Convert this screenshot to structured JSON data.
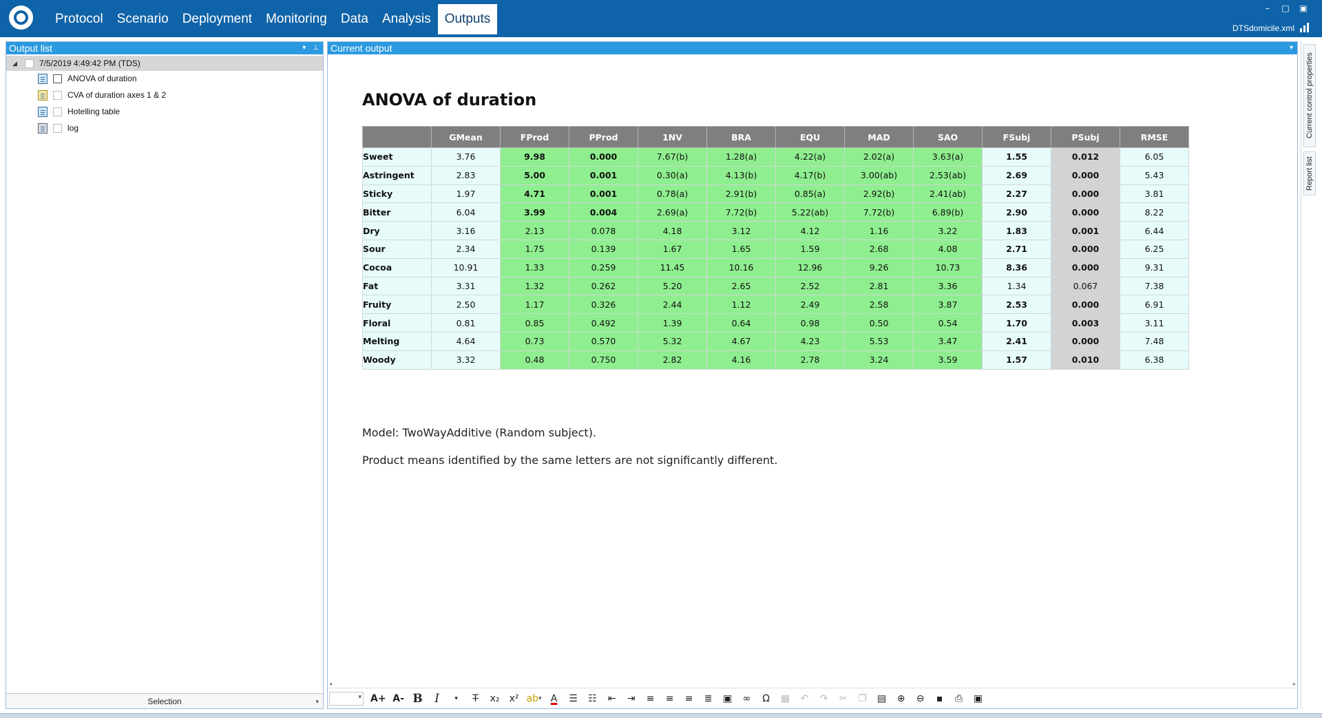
{
  "menu": {
    "items": [
      "Protocol",
      "Scenario",
      "Deployment",
      "Monitoring",
      "Data",
      "Analysis",
      "Outputs"
    ],
    "active": "Outputs"
  },
  "window": {
    "filename": "DTSdomicile.xml",
    "controls": {
      "minimize": "–",
      "restore": "□",
      "maximize": "▣"
    }
  },
  "output_list": {
    "title": "Output list",
    "root": "7/5/2019 4:49:42 PM (TDS)",
    "items": [
      "ANOVA of duration",
      "CVA of duration axes 1 & 2",
      "Hotelling table",
      "log"
    ],
    "footer": "Selection"
  },
  "current_output": {
    "title": "Current output",
    "doc_title": "ANOVA of duration",
    "columns": [
      "",
      "GMean",
      "FProd",
      "PProd",
      "1NV",
      "BRA",
      "EQU",
      "MAD",
      "SAO",
      "FSubj",
      "PSubj",
      "RMSE"
    ],
    "rows": [
      [
        "Sweet",
        "3.76",
        "9.98",
        "0.000",
        "7.67(b)",
        "1.28(a)",
        "4.22(a)",
        "2.02(a)",
        "3.63(a)",
        "1.55",
        "0.012",
        "6.05"
      ],
      [
        "Astringent",
        "2.83",
        "5.00",
        "0.001",
        "0.30(a)",
        "4.13(b)",
        "4.17(b)",
        "3.00(ab)",
        "2.53(ab)",
        "2.69",
        "0.000",
        "5.43"
      ],
      [
        "Sticky",
        "1.97",
        "4.71",
        "0.001",
        "0.78(a)",
        "2.91(b)",
        "0.85(a)",
        "2.92(b)",
        "2.41(ab)",
        "2.27",
        "0.000",
        "3.81"
      ],
      [
        "Bitter",
        "6.04",
        "3.99",
        "0.004",
        "2.69(a)",
        "7.72(b)",
        "5.22(ab)",
        "7.72(b)",
        "6.89(b)",
        "2.90",
        "0.000",
        "8.22"
      ],
      [
        "Dry",
        "3.16",
        "2.13",
        "0.078",
        "4.18",
        "3.12",
        "4.12",
        "1.16",
        "3.22",
        "1.83",
        "0.001",
        "6.44"
      ],
      [
        "Sour",
        "2.34",
        "1.75",
        "0.139",
        "1.67",
        "1.65",
        "1.59",
        "2.68",
        "4.08",
        "2.71",
        "0.000",
        "6.25"
      ],
      [
        "Cocoa",
        "10.91",
        "1.33",
        "0.259",
        "11.45",
        "10.16",
        "12.96",
        "9.26",
        "10.73",
        "8.36",
        "0.000",
        "9.31"
      ],
      [
        "Fat",
        "3.31",
        "1.32",
        "0.262",
        "5.20",
        "2.65",
        "2.52",
        "2.81",
        "3.36",
        "1.34",
        "0.067",
        "7.38"
      ],
      [
        "Fruity",
        "2.50",
        "1.17",
        "0.326",
        "2.44",
        "1.12",
        "2.49",
        "2.58",
        "3.87",
        "2.53",
        "0.000",
        "6.91"
      ],
      [
        "Floral",
        "0.81",
        "0.85",
        "0.492",
        "1.39",
        "0.64",
        "0.98",
        "0.50",
        "0.54",
        "1.70",
        "0.003",
        "3.11"
      ],
      [
        "Melting",
        "4.64",
        "0.73",
        "0.570",
        "5.32",
        "4.67",
        "4.23",
        "5.53",
        "3.47",
        "2.41",
        "0.000",
        "7.48"
      ],
      [
        "Woody",
        "3.32",
        "0.48",
        "0.750",
        "2.82",
        "4.16",
        "2.78",
        "3.24",
        "3.59",
        "1.57",
        "0.010",
        "6.38"
      ]
    ],
    "significant_product_rows": 4,
    "nonsignificant_subject_rows": [
      "Fat"
    ],
    "model_note": "Model: TwoWayAdditive (Random subject).",
    "letters_note": "Product means identified by the same letters are not significantly different."
  },
  "colors": {
    "topbar": "#0f63a8",
    "panel_header": "#2b9ae0",
    "table_header": "#7f7f7f",
    "green_cell": "#8fee8f",
    "gray_cell": "#d3d3d3",
    "light_cell": "#e8fbfb"
  },
  "toolbar": {
    "grow_font": "A+",
    "shrink_font": "A-",
    "bold": "B",
    "italic": "I",
    "strike": "T",
    "subscript": "x₂",
    "superscript": "x²",
    "font_color": "A",
    "special_char": "Ω"
  },
  "side_tabs": [
    "Current control properties",
    "Report list"
  ]
}
